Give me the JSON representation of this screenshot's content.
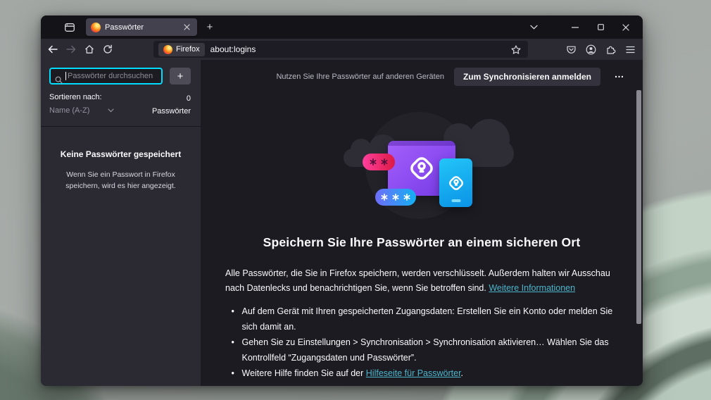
{
  "colors": {
    "accent_focus": "#00ddff",
    "link": "#4cb5cc",
    "window_bg": "#1c1b22",
    "sidebar_bg": "#2b2a33",
    "toolbar_bg": "#2b2a33",
    "tabbar_bg": "#141318",
    "active_tab_bg": "#42414d",
    "illustration_purple": "#8a4bf0",
    "illustration_blue": "#0a93e6",
    "illustration_pink": "#ff3f9d",
    "wallpaper_sage": "#b7c9bc"
  },
  "icons": {
    "firefox_view": "browser-window-glyph",
    "firefox_logo": "orange-gradient-ball",
    "tab_close": "x-glyph",
    "new_tab": "+",
    "tabs_chevron": "chevron-down",
    "minimize": "horizontal-line",
    "maximize": "square-outline",
    "window_close": "x-glyph",
    "back": "arrow-left",
    "forward": "arrow-right",
    "home": "house-outline",
    "reload": "circular-arrow",
    "bookmark": "star-outline",
    "pocket": "circle-chevron-down",
    "account": "person-in-circle",
    "extensions": "puzzle-piece",
    "menu": "hamburger-three-lines",
    "search": "magnifier",
    "lock_logo": "diamond-keyhole",
    "asterisk": "six-spoke-star"
  },
  "tab_bar": {
    "tab_title": "Passwörter",
    "new_tab_label": "+"
  },
  "toolbar": {
    "site_chip": "Firefox",
    "url": "about:logins"
  },
  "page_header": {
    "sync_hint": "Nutzen Sie Ihre Passwörter auf anderen Geräten",
    "sync_button": "Zum Synchronisieren anmelden",
    "more_label": "…"
  },
  "sidebar": {
    "search_placeholder": "Passwörter durchsuchen",
    "add_button": "+",
    "sort_label": "Sortieren nach:",
    "sort_value": "Name (A-Z)",
    "count_value": "0",
    "count_label": "Passwörter",
    "empty_title": "Keine Passwörter gespeichert",
    "empty_body": "Wenn Sie ein Passwort in Firefox speichern, wird es hier angezeigt."
  },
  "main": {
    "title": "Speichern Sie Ihre Passwörter an einem sicheren Ort",
    "intro_text": "Alle Passwörter, die Sie in Firefox speichern, werden verschlüsselt. Außerdem halten wir Ausschau nach Datenlecks und benachrichtigen Sie, wenn Sie betroffen sind. ",
    "intro_link": "Weitere Informationen",
    "bullet_1": "Auf dem Gerät mit Ihren gespeicherten Zugangsdaten: Erstellen Sie ein Konto oder melden Sie sich damit an.",
    "bullet_2": "Gehen Sie zu Einstellungen > Synchronisation > Synchronisation aktivieren… Wählen Sie das Kontrollfeld “Zugangsdaten und Passwörter”.",
    "bullet_3_before": "Weitere Hilfe finden Sie auf der ",
    "bullet_3_link": "Hilfeseite für Passwörter",
    "bullet_3_after": "."
  }
}
